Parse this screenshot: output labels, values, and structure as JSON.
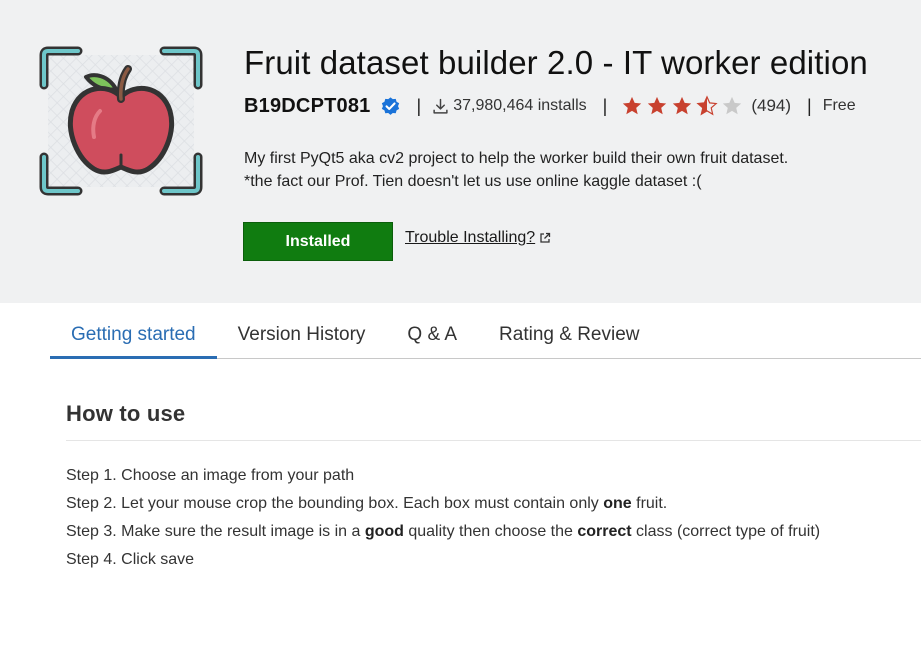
{
  "extension": {
    "name": "Fruit dataset builder 2.0 - IT worker edition",
    "publisher": "B19DCPT081",
    "installs": "37,980,464 installs",
    "rating_count": "(494)",
    "rating": 3.5,
    "price": "Free",
    "separator": "|",
    "description_line1": "My first PyQt5 aka cv2 project to help the worker build their own fruit dataset.",
    "description_line2": "*the fact our Prof. Tien doesn't let us use online kaggle dataset :("
  },
  "actions": {
    "installed_label": "Installed",
    "trouble_label": "Trouble Installing?"
  },
  "tabs": [
    {
      "label": "Getting started",
      "active": true
    },
    {
      "label": "Version History",
      "active": false
    },
    {
      "label": "Q & A",
      "active": false
    },
    {
      "label": "Rating & Review",
      "active": false
    }
  ],
  "content": {
    "heading": "How to use",
    "step1": "Step 1. Choose an image from your path",
    "step2_pre": "Step 2. Let your mouse crop the bounding box. Each box must contain only ",
    "step2_bold": "one",
    "step2_post": " fruit.",
    "step3_pre": "Step 3. Make sure the result image is in a ",
    "step3_bold1": "good",
    "step3_mid": " quality then choose the ",
    "step3_bold2": "correct",
    "step3_post": " class (correct type of fruit)",
    "step4": "Step 4. Click save"
  },
  "colors": {
    "header_bg": "#f0f1f2",
    "installed_green": "#107c10",
    "tab_active_blue": "#2a6db3",
    "star_red": "#c8412f",
    "star_empty": "#c9c9c9",
    "verified_blue": "#1a73d9"
  },
  "icons": [
    "apple-scan-logo",
    "verified-badge-icon",
    "download-icon",
    "star-icon",
    "external-link-icon"
  ]
}
